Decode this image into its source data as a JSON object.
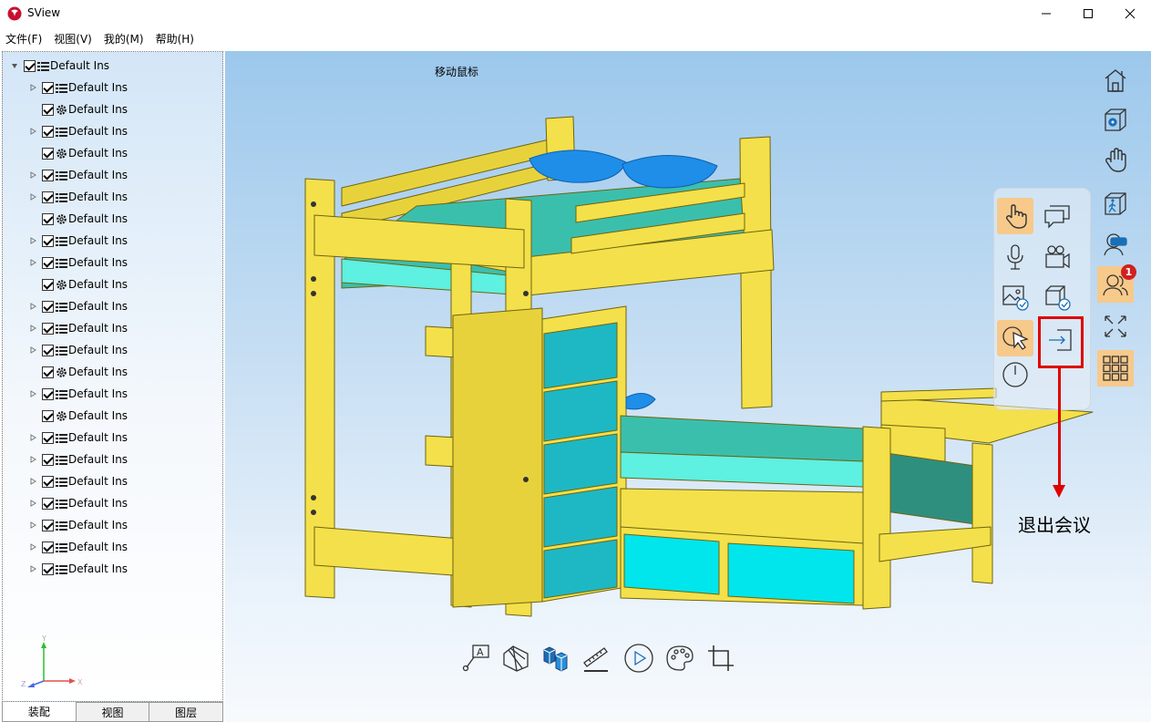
{
  "window": {
    "title": "SView"
  },
  "menu": [
    {
      "label": "文件(F)"
    },
    {
      "label": "视图(V)"
    },
    {
      "label": "我的(M)"
    },
    {
      "label": "帮助(H)"
    }
  ],
  "tree": {
    "root": {
      "label": "Default Ins",
      "expanded": true,
      "checked": true
    },
    "children": [
      {
        "label": "Default Ins",
        "kind": "assembly",
        "expandable": true,
        "checked": true
      },
      {
        "label": "Default Ins",
        "kind": "part",
        "expandable": false,
        "checked": true
      },
      {
        "label": "Default Ins",
        "kind": "assembly",
        "expandable": true,
        "checked": true
      },
      {
        "label": "Default Ins",
        "kind": "part",
        "expandable": false,
        "checked": true
      },
      {
        "label": "Default Ins",
        "kind": "assembly",
        "expandable": true,
        "checked": true
      },
      {
        "label": "Default Ins",
        "kind": "assembly",
        "expandable": true,
        "checked": true
      },
      {
        "label": "Default Ins",
        "kind": "part",
        "expandable": false,
        "checked": true
      },
      {
        "label": "Default Ins",
        "kind": "assembly",
        "expandable": true,
        "checked": true
      },
      {
        "label": "Default Ins",
        "kind": "assembly",
        "expandable": true,
        "checked": true
      },
      {
        "label": "Default Ins",
        "kind": "part",
        "expandable": false,
        "checked": true
      },
      {
        "label": "Default Ins",
        "kind": "assembly",
        "expandable": true,
        "checked": true
      },
      {
        "label": "Default Ins",
        "kind": "assembly",
        "expandable": true,
        "checked": true
      },
      {
        "label": "Default Ins",
        "kind": "assembly",
        "expandable": true,
        "checked": true
      },
      {
        "label": "Default Ins",
        "kind": "part",
        "expandable": false,
        "checked": true
      },
      {
        "label": "Default Ins",
        "kind": "assembly",
        "expandable": true,
        "checked": true
      },
      {
        "label": "Default Ins",
        "kind": "part",
        "expandable": false,
        "checked": true
      },
      {
        "label": "Default Ins",
        "kind": "assembly",
        "expandable": true,
        "checked": true
      },
      {
        "label": "Default Ins",
        "kind": "assembly",
        "expandable": true,
        "checked": true
      },
      {
        "label": "Default Ins",
        "kind": "assembly",
        "expandable": true,
        "checked": true
      },
      {
        "label": "Default Ins",
        "kind": "assembly",
        "expandable": true,
        "checked": true
      },
      {
        "label": "Default Ins",
        "kind": "assembly",
        "expandable": true,
        "checked": true
      },
      {
        "label": "Default Ins",
        "kind": "assembly",
        "expandable": true,
        "checked": true
      },
      {
        "label": "Default Ins",
        "kind": "assembly",
        "expandable": true,
        "checked": true
      }
    ]
  },
  "axes": {
    "x": "X",
    "y": "Y",
    "z": "Z"
  },
  "tabs": [
    {
      "label": "装配",
      "active": true
    },
    {
      "label": "视图",
      "active": false
    },
    {
      "label": "图层",
      "active": false
    }
  ],
  "viewport": {
    "hint": "移动鼠标"
  },
  "right_toolbar": [
    {
      "icon": "home-icon",
      "active": false
    },
    {
      "icon": "view-settings-cube-icon",
      "active": false
    },
    {
      "icon": "pan-hand-icon",
      "active": false
    },
    {
      "icon": "walkthrough-cube-icon",
      "active": false
    },
    {
      "icon": "vr-headset-icon",
      "active": false
    },
    {
      "icon": "meeting-users-icon",
      "active": true,
      "badge": "1"
    },
    {
      "icon": "fullscreen-icon",
      "active": false
    },
    {
      "icon": "app-grid-icon",
      "active": true
    }
  ],
  "meeting_panel": [
    {
      "icon": "meeting-hand-icon",
      "active": true
    },
    {
      "icon": "chat-icon",
      "active": false
    },
    {
      "icon": "microphone-icon",
      "active": false
    },
    {
      "icon": "video-camera-icon",
      "active": false
    },
    {
      "icon": "image-share-icon",
      "active": false
    },
    {
      "icon": "model-share-icon",
      "active": false
    },
    {
      "icon": "pointer-cursor-icon",
      "active": true
    },
    {
      "icon": "exit-meeting-icon",
      "active": false
    },
    {
      "icon": "timer-icon",
      "active": false
    }
  ],
  "annotation": {
    "label": "退出会议",
    "color": "#e00000"
  },
  "bottom_toolbar": [
    {
      "icon": "annotation-icon"
    },
    {
      "icon": "section-view-icon"
    },
    {
      "icon": "explode-view-icon"
    },
    {
      "icon": "measure-icon"
    },
    {
      "icon": "play-animation-icon"
    },
    {
      "icon": "palette-icon"
    },
    {
      "icon": "crop-icon"
    }
  ],
  "colors": {
    "accent_active": "#f7c98a",
    "wood": "#f4e04a",
    "mattress": "#46c8b4",
    "drawer": "#1eb8c4",
    "pillow": "#1e8ee8"
  }
}
